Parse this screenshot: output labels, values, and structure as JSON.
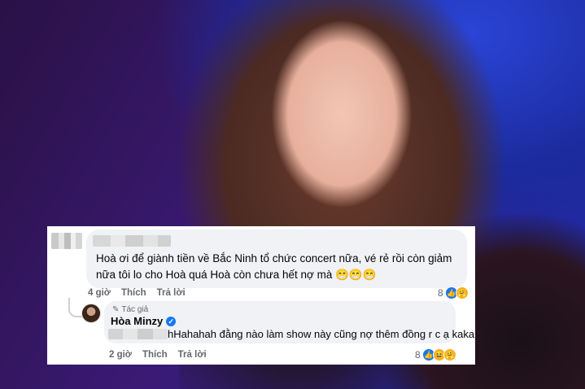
{
  "comment1": {
    "text": "Hoà ơi để giành tiền về Bắc Ninh tổ chức concert nữa, vé rẻ rồi còn giảm nữa tôi lo cho Hoà quá Hoà còn chưa hết nợ mà 😁😁😁",
    "time": "4 giờ",
    "like_label": "Thích",
    "reply_label": "Trả lời",
    "reaction_count": "8",
    "reactions": [
      "like",
      "care"
    ]
  },
  "comment2": {
    "author_badge": "Tác giả",
    "author_name": "Hòa Minzy",
    "text": "hHahahah đằng nào làm show này cũng nợ thêm đồng r c ạ kaka",
    "time": "2 giờ",
    "like_label": "Thích",
    "reply_label": "Trả lời",
    "reaction_count": "8",
    "reactions": [
      "like",
      "haha",
      "care"
    ]
  },
  "icons": {
    "pencil": "pencil-icon",
    "verified": "verified-badge-icon",
    "like": "like-reaction-icon",
    "haha": "haha-reaction-icon",
    "care": "care-reaction-icon"
  },
  "colors": {
    "link_blue": "#1877f2",
    "bubble": "#f0f2f5",
    "meta_gray": "#65676b"
  }
}
